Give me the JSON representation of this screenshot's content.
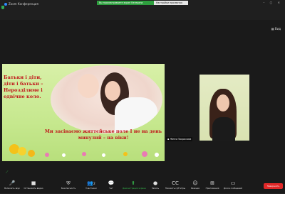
{
  "window": {
    "title": "Zoom Конференция",
    "share_banner": "Вы просматриваете экран Катерина",
    "share_settings": "Настройки просмотра",
    "window_controls": "–  ▢  ✕",
    "view_label": "Вид"
  },
  "slide": {
    "text_left": "Батьки і діти, діти і батьки – Нерозділиме і одвічне коло.",
    "text_bottom": "Ми засіваємо життєйське поле І не на день минулий – на віки!"
  },
  "participant": {
    "name": "Женя Покрасова"
  },
  "toolbar": {
    "items": [
      {
        "label": "Включить звук",
        "icon": "mic-icon"
      },
      {
        "label": "Остановить видео",
        "icon": "video-icon"
      },
      {
        "label": "Безопасность",
        "icon": "shield-icon"
      },
      {
        "label": "Участники",
        "icon": "participants-icon",
        "count": "2"
      },
      {
        "label": "Чат",
        "icon": "chat-icon"
      },
      {
        "label": "Демонстрация экрана",
        "icon": "share-icon"
      },
      {
        "label": "Запись",
        "icon": "record-icon"
      },
      {
        "label": "Показать субтитры",
        "icon": "cc-icon"
      },
      {
        "label": "Реакции",
        "icon": "reactions-icon"
      },
      {
        "label": "Приложения",
        "icon": "apps-icon"
      },
      {
        "label": "Доска сообщений",
        "icon": "whiteboard-icon"
      }
    ],
    "leave_label": "Завершить",
    "participants_count": "2"
  },
  "colors": {
    "accent_green": "#35b24a",
    "leave_red": "#e02828",
    "slide_text_red": "#c0161a"
  }
}
